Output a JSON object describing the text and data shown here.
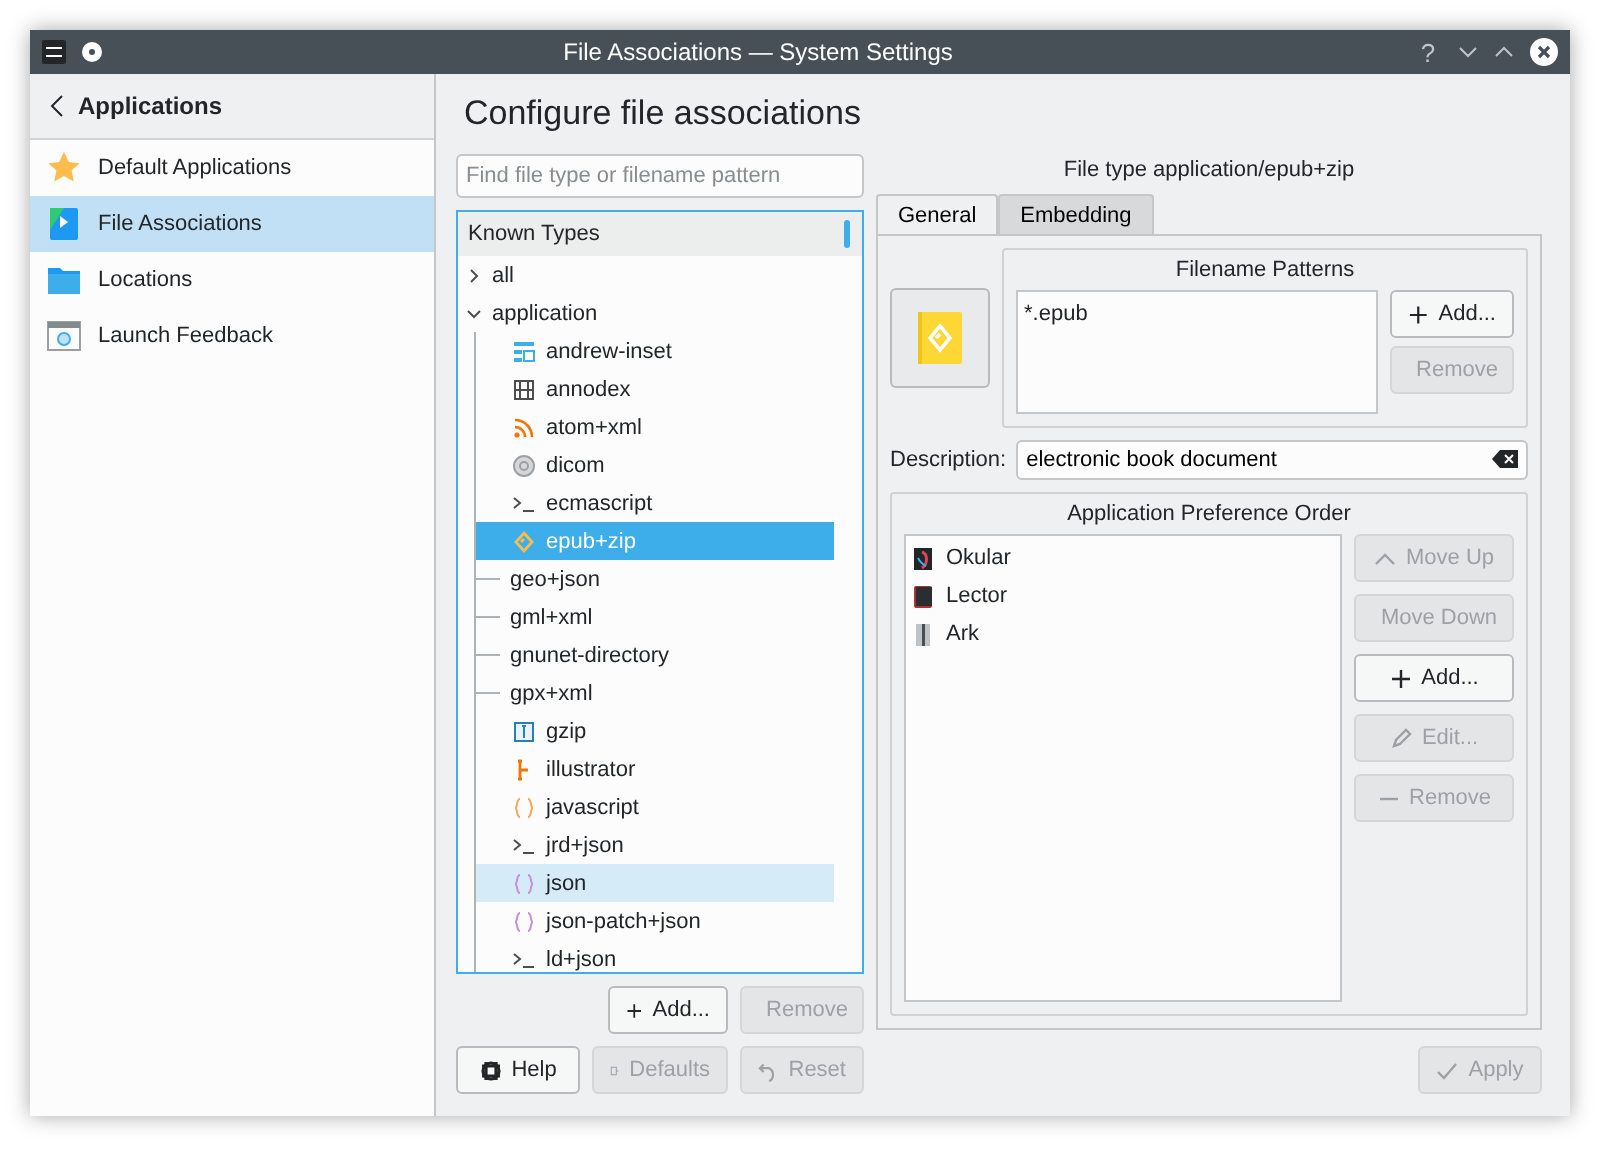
{
  "window": {
    "title": "File Associations — System Settings",
    "help_button": "?"
  },
  "sidebar": {
    "back_label": "Applications",
    "items": [
      {
        "label": "Default Applications",
        "selected": false
      },
      {
        "label": "File Associations",
        "selected": true
      },
      {
        "label": "Locations",
        "selected": false
      },
      {
        "label": "Launch Feedback",
        "selected": false
      }
    ]
  },
  "page": {
    "heading": "Configure file associations",
    "search": {
      "placeholder": "Find file type or filename pattern"
    },
    "tree": {
      "header": "Known Types",
      "items": [
        {
          "label": "all",
          "expanded": false
        },
        {
          "label": "application",
          "expanded": true,
          "children": [
            {
              "label": "andrew-inset",
              "selected": false,
              "hovered": false
            },
            {
              "label": "annodex",
              "selected": false,
              "hovered": false
            },
            {
              "label": "atom+xml",
              "selected": false,
              "hovered": false
            },
            {
              "label": "dicom",
              "selected": false,
              "hovered": false
            },
            {
              "label": "ecmascript",
              "selected": false,
              "hovered": false
            },
            {
              "label": "epub+zip",
              "selected": true,
              "hovered": false
            },
            {
              "label": "geo+json",
              "selected": false,
              "hovered": false
            },
            {
              "label": "gml+xml",
              "selected": false,
              "hovered": false
            },
            {
              "label": "gnunet-directory",
              "selected": false,
              "hovered": false
            },
            {
              "label": "gpx+xml",
              "selected": false,
              "hovered": false
            },
            {
              "label": "gzip",
              "selected": false,
              "hovered": false
            },
            {
              "label": "illustrator",
              "selected": false,
              "hovered": false
            },
            {
              "label": "javascript",
              "selected": false,
              "hovered": false
            },
            {
              "label": "jrd+json",
              "selected": false,
              "hovered": false
            },
            {
              "label": "json",
              "selected": false,
              "hovered": true
            },
            {
              "label": "json-patch+json",
              "selected": false,
              "hovered": false
            },
            {
              "label": "ld+json",
              "selected": false,
              "hovered": false
            }
          ]
        }
      ]
    },
    "tree_buttons": [
      {
        "label": "Add...",
        "disabled": false
      },
      {
        "label": "Remove",
        "disabled": true
      }
    ],
    "footer_buttons": [
      {
        "label": "Help",
        "disabled": false
      },
      {
        "label": "Defaults",
        "disabled": true
      },
      {
        "label": "Reset",
        "disabled": true
      }
    ]
  },
  "details": {
    "title": "File type application/epub+zip",
    "tabs": [
      {
        "label": "General",
        "selected": true
      },
      {
        "label": "Embedding",
        "selected": false
      }
    ],
    "patterns": {
      "title": "Filename Patterns",
      "items": [
        "*.epub"
      ],
      "buttons": [
        {
          "label": "Add...",
          "disabled": false
        },
        {
          "label": "Remove",
          "disabled": true
        }
      ]
    },
    "description": {
      "label": "Description:",
      "value": "electronic book document"
    },
    "apps": {
      "title": "Application Preference Order",
      "items": [
        "Okular",
        "Lector",
        "Ark"
      ],
      "buttons": [
        {
          "label": "Move Up",
          "disabled": true
        },
        {
          "label": "Move Down",
          "disabled": true
        },
        {
          "label": "Add...",
          "disabled": false
        },
        {
          "label": "Edit...",
          "disabled": true
        },
        {
          "label": "Remove",
          "disabled": true
        }
      ]
    },
    "apply": {
      "label": "Apply",
      "disabled": true
    }
  }
}
